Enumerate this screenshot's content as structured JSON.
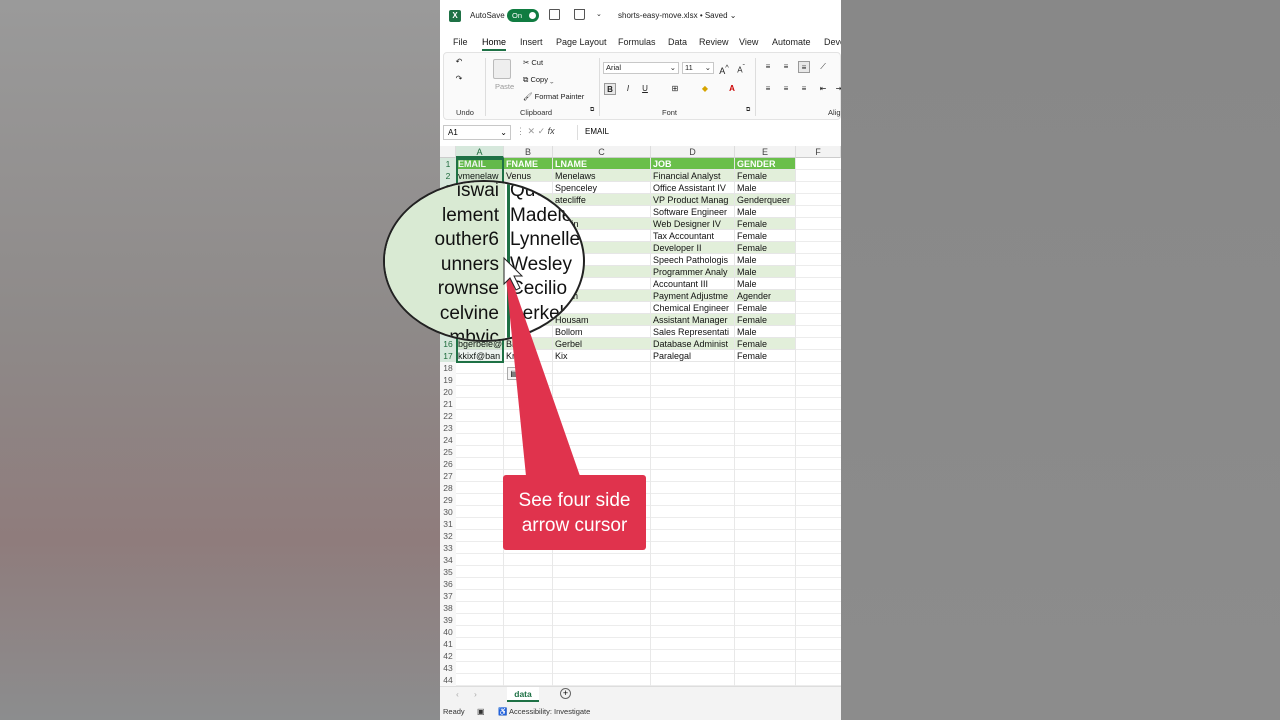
{
  "title_bar": {
    "autosave_label": "AutoSave",
    "toggle_state": "On",
    "filename": "shorts-easy-move.xlsx",
    "save_status": "• Saved"
  },
  "tabs": [
    "File",
    "Home",
    "Insert",
    "Page Layout",
    "Formulas",
    "Data",
    "Review",
    "View",
    "Automate",
    "Deve"
  ],
  "active_tab": "Home",
  "ribbon": {
    "undo_group": "Undo",
    "paste_label": "Paste",
    "cut": "Cut",
    "copy": "Copy",
    "format_painter": "Format Painter",
    "clipboard_group": "Clipboard",
    "font_name": "Arial",
    "font_size": "11",
    "font_group": "Font",
    "align_group": "Alig",
    "bold": "B",
    "italic": "I",
    "underline": "U",
    "grow": "A",
    "shrink": "A"
  },
  "formula_bar": {
    "name_box": "A1",
    "fx": "fx",
    "content": "EMAIL"
  },
  "columns": [
    "A",
    "B",
    "C",
    "D",
    "E",
    "F"
  ],
  "headers": [
    "EMAIL",
    "FNAME",
    "LNAME",
    "JOB",
    "GENDER"
  ],
  "rows": [
    [
      "vmenelaw",
      "Venus",
      "Menelaws",
      "Financial Analyst",
      "Female"
    ],
    [
      "",
      "",
      "Spenceley",
      "Office Assistant IV",
      "Male"
    ],
    [
      "",
      "",
      "atecliffe",
      "VP Product Manag",
      "Genderqueer"
    ],
    [
      "",
      "",
      "be",
      "Software Engineer",
      "Male"
    ],
    [
      "",
      "",
      "ewain",
      "Web Designer IV",
      "Female"
    ],
    [
      "",
      "",
      "enti",
      "Tax Accountant",
      "Female"
    ],
    [
      "",
      "",
      "er",
      "Developer II",
      "Female"
    ],
    [
      "",
      "",
      "rs",
      "Speech Pathologis",
      "Male"
    ],
    [
      "",
      "",
      "sey",
      "Programmer Analy",
      "Male"
    ],
    [
      "",
      "",
      "ine",
      "Accountant III",
      "Male"
    ],
    [
      "",
      "",
      "nwich",
      "Payment Adjustme",
      "Agender"
    ],
    [
      "",
      "",
      "de",
      "Chemical Engineer",
      "Female"
    ],
    [
      "",
      "",
      "Housam",
      "Assistant Manager",
      "Female"
    ],
    [
      "m",
      "D",
      "Bollom",
      "Sales Representati",
      "Male"
    ],
    [
      "bgerbele@",
      "Bri",
      "Gerbel",
      "Database Administ",
      "Female"
    ],
    [
      "kkixf@ban",
      "Kry",
      "Kix",
      "Paralegal",
      "Female"
    ]
  ],
  "row_numbers": [
    "1",
    "2",
    "3",
    "4",
    "5",
    "6",
    "7",
    "8",
    "9",
    "10",
    "11",
    "12",
    "13",
    "14",
    "15",
    "16",
    "17",
    "18",
    "19",
    "20",
    "21",
    "22",
    "23",
    "24",
    "25",
    "26",
    "27",
    "28",
    "29",
    "30",
    "31",
    "32",
    "33",
    "34",
    "35",
    "36",
    "37",
    "38",
    "39",
    "40",
    "41",
    "42",
    "43",
    "44"
  ],
  "magnifier": {
    "col_a": [
      "iswai",
      "lement",
      "outher6",
      "unners",
      "rownse",
      "celvine",
      "mbvic"
    ],
    "col_b": [
      "Que",
      "Madele",
      "Lynnelle",
      "Wesley",
      "Cecilio",
      "Berkel",
      ""
    ]
  },
  "callout": {
    "line1": "See four side",
    "line2": "arrow cursor",
    "color": "#e0334d"
  },
  "sheet_tab": "data",
  "status": {
    "ready": "Ready",
    "accessibility": "Accessibility: Investigate"
  },
  "colors": {
    "header_fill": "#6abf4b",
    "band_fill": "#e2efda",
    "excel_green": "#1e7145"
  }
}
